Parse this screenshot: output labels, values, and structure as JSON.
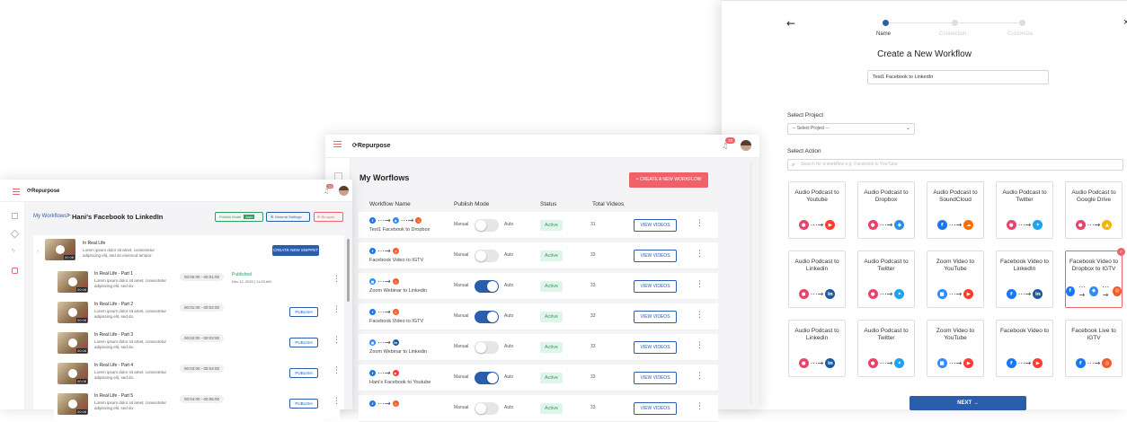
{
  "colors": {
    "accent": "#2b5dad",
    "brand_red": "#f0626a",
    "active_green": "#2f9e5f"
  },
  "wizard": {
    "back_icon": "arrow-left-icon",
    "steps": [
      {
        "label": "Name",
        "active": true
      },
      {
        "label": "Connection",
        "active": false
      },
      {
        "label": "Customize",
        "active": false
      }
    ],
    "title": "Create a New Workflow",
    "name_value": "Test1 Facebook to LinkedIn",
    "select_project_label": "Select Project",
    "select_project_value": "-- Select Project --",
    "select_action_label": "Select Action",
    "search_placeholder": "Search for a workflow e.g. Facebook to YouTube",
    "actions": [
      {
        "title": "Audio Podcast to Youtube",
        "from": "podcast",
        "to": "youtube",
        "selected": false
      },
      {
        "title": "Audio Podcast to Dropbox",
        "from": "podcast",
        "to": "dropbox",
        "selected": false
      },
      {
        "title": "Audio Podcast to SoundCloud",
        "from": "facebook",
        "to": "soundcloud",
        "selected": false
      },
      {
        "title": "Audio Podcast to Twitter",
        "from": "podcast",
        "to": "twitter",
        "selected": false
      },
      {
        "title": "Audio Podcast to Google Drive",
        "from": "podcast",
        "to": "gdrive",
        "selected": false
      },
      {
        "title": "Audio Podcast to Linkedin",
        "from": "podcast",
        "to": "linkedin",
        "selected": false
      },
      {
        "title": "Audio Podcast to Twitter",
        "from": "podcast",
        "to": "twitter",
        "selected": false
      },
      {
        "title": "Zoom Video to YouTube",
        "from": "zoom",
        "to": "youtube",
        "selected": false
      },
      {
        "title": "Facebook Video to LinkedIn",
        "from": "facebook",
        "to": "linkedin",
        "selected": false
      },
      {
        "title": "Facebook Video to Dropbox to IGTV",
        "from": "facebook",
        "to": "igtv",
        "mid": "dropbox",
        "selected": true
      },
      {
        "title": "Audio Podcast to Linkedin",
        "from": "podcast",
        "to": "linkedin",
        "selected": false
      },
      {
        "title": "Audio Podcast to Twitter",
        "from": "podcast",
        "to": "twitter",
        "selected": false
      },
      {
        "title": "Zoom Video to YouTube",
        "from": "zoom",
        "to": "youtube",
        "selected": false
      },
      {
        "title": "Facebook Video to",
        "from": "facebook",
        "to": "youtube",
        "selected": false
      },
      {
        "title": "Facebook Live to IGTV",
        "from": "facebook",
        "to": "igtv",
        "selected": false
      }
    ],
    "next_label": "NEXT →"
  },
  "workflows": {
    "brand": "Repurpose",
    "notif_count": "15",
    "title": "My Worflows",
    "create_label": "+ CREATE A NEW WORKFLOW",
    "headers": [
      "Workflow Name",
      "Publish Mode",
      "Status",
      "Total Videos"
    ],
    "manual_label": "Manual",
    "auto_label": "Auto",
    "view_label": "VIEW VIDEOS",
    "rows": [
      {
        "name": "Test1 Facebook to Dropbox",
        "auto": false,
        "status": "Active",
        "total": "31",
        "icons": [
          "facebook",
          "dropbox",
          "igtv"
        ]
      },
      {
        "name": "Facebook Video to IGTV",
        "auto": false,
        "status": "Active",
        "total": "33",
        "icons": [
          "facebook",
          "igtv"
        ]
      },
      {
        "name": "Zoom Webinar to Linkedin",
        "auto": true,
        "status": "Active",
        "total": "33",
        "icons": [
          "zoom",
          "igtv"
        ]
      },
      {
        "name": "Facebook Video to IGTV",
        "auto": true,
        "status": "Active",
        "total": "33",
        "icons": [
          "facebook",
          "igtv"
        ]
      },
      {
        "name": "Zoom Webinar to Linkedin",
        "auto": false,
        "status": "Active",
        "total": "33",
        "icons": [
          "zoom",
          "linkedin"
        ]
      },
      {
        "name": "Hani's Facebook to Youtube",
        "auto": true,
        "status": "Active",
        "total": "33",
        "icons": [
          "facebook",
          "youtube"
        ]
      },
      {
        "name": "",
        "auto": false,
        "status": "Active",
        "total": "33",
        "icons": [
          "facebook",
          "igtv"
        ]
      }
    ]
  },
  "episodes": {
    "brand": "Repurpose",
    "notif_count": "12",
    "crumb_root": "My Workflows",
    "crumb_sep": ">",
    "crumb_current": "Hani's Facebook to LinkedIn",
    "publish_mode_label": "Publish Mode",
    "publish_mode_badge": "Auto",
    "general_settings_label": "General Settings",
    "retry_label": "Re-sync",
    "parent": {
      "title": "In Real Life",
      "desc": "Lorem ipsum dolor sit amet, consectetur adipiscing elit, sed do eiusmod tempor.",
      "dur": "00:08",
      "create_label": "CREATE NEW SNIPPET"
    },
    "snippets": [
      {
        "title": "In Real Life - Part 1",
        "desc": "Lorem ipsum dolor sit amet, consectetur adipiscing elit, sed do.",
        "time": "00:00:00 - 00:01:00",
        "status": "Published",
        "date": "Dec 12, 2020 | 11:03 AM",
        "dur": "00:08",
        "publish": ""
      },
      {
        "title": "In Real Life - Part 2",
        "desc": "Lorem ipsum dolor sit amet, consectetur adipiscing elit, sed do.",
        "time": "00:01:00 - 00:02:00",
        "status": "",
        "date": "",
        "dur": "00:08",
        "publish": "PUBLISH"
      },
      {
        "title": "In Real Life - Part 3",
        "desc": "Lorem ipsum dolor sit amet, consectetur adipiscing elit, sed do.",
        "time": "00:02:00 - 00:03:00",
        "status": "",
        "date": "",
        "dur": "00:08",
        "publish": "PUBLISH"
      },
      {
        "title": "In Real Life - Part 4",
        "desc": "Lorem ipsum dolor sit amet, consectetur adipiscing elit, sed do.",
        "time": "00:03:00 - 00:04:00",
        "status": "",
        "date": "",
        "dur": "00:08",
        "publish": "PUBLISH"
      },
      {
        "title": "In Real Life - Part 5",
        "desc": "Lorem ipsum dolor sit amet, consectetur adipiscing elit, sed do.",
        "time": "00:04:00 - 00:05:00",
        "status": "",
        "date": "",
        "dur": "00:08",
        "publish": "PUBLISH"
      }
    ]
  }
}
